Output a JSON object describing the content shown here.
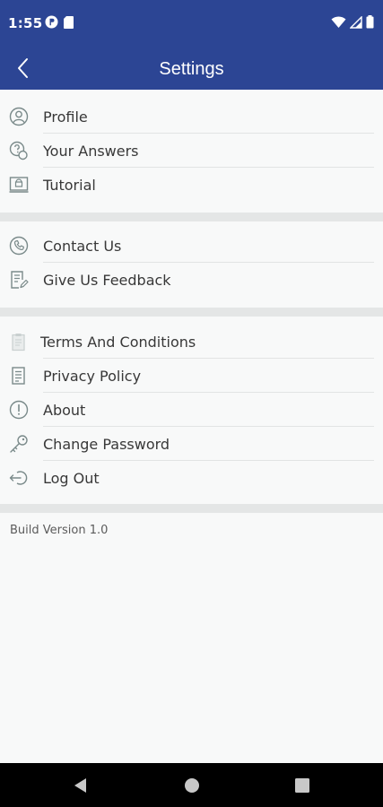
{
  "status_bar": {
    "time": "1:55"
  },
  "app_bar": {
    "title": "Settings"
  },
  "sections": [
    {
      "items": [
        {
          "label": "Profile",
          "icon": "profile-icon"
        },
        {
          "label": "Your Answers",
          "icon": "answers-icon"
        },
        {
          "label": "Tutorial",
          "icon": "tutorial-icon"
        }
      ]
    },
    {
      "items": [
        {
          "label": "Contact Us",
          "icon": "phone-icon"
        },
        {
          "label": "Give Us Feedback",
          "icon": "feedback-icon"
        }
      ]
    },
    {
      "items": [
        {
          "label": "Terms And Conditions",
          "icon": "clipboard-icon"
        },
        {
          "label": "Privacy Policy",
          "icon": "document-icon"
        },
        {
          "label": "About",
          "icon": "info-icon"
        },
        {
          "label": "Change Password",
          "icon": "key-icon"
        },
        {
          "label": "Log Out",
          "icon": "logout-icon"
        }
      ]
    }
  ],
  "footer": {
    "build_version": "Build Version 1.0"
  },
  "colors": {
    "header": "#2c4594",
    "icon": "#7a8a8a",
    "text": "#383838"
  }
}
